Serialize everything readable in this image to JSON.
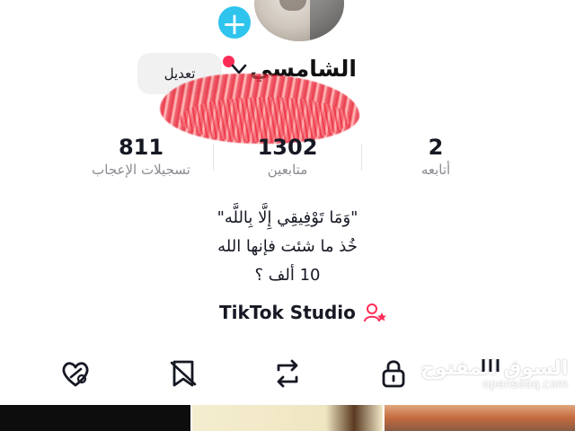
{
  "profile": {
    "username": "الشامسي",
    "edit_label": "تعديل",
    "add_symbol": "+"
  },
  "stats": [
    {
      "value": "811",
      "label": "تسجيلات الإعجاب"
    },
    {
      "value": "1302",
      "label": "متابعين"
    },
    {
      "value": "2",
      "label": "أتابعه"
    }
  ],
  "bio": {
    "line1": "\"وَمَا تَوْفِيقِي إِلَّا بِاللَّه\"",
    "line2": "خُذ ما شئت فإنها الله",
    "line3": "10 ألف ؟"
  },
  "studio": {
    "label": "TikTok Studio"
  },
  "watermark": {
    "ar": "السوق المفتوح",
    "en": "opensooq.com"
  },
  "colors": {
    "accent_red": "#fe2c55",
    "add_blue": "#2fc4ee",
    "muted_text": "#8a8b91"
  },
  "icons": {
    "tabs": [
      "liked-heart-icon",
      "favorites-icon",
      "repost-icon",
      "lock-icon",
      "grid-icon"
    ]
  }
}
